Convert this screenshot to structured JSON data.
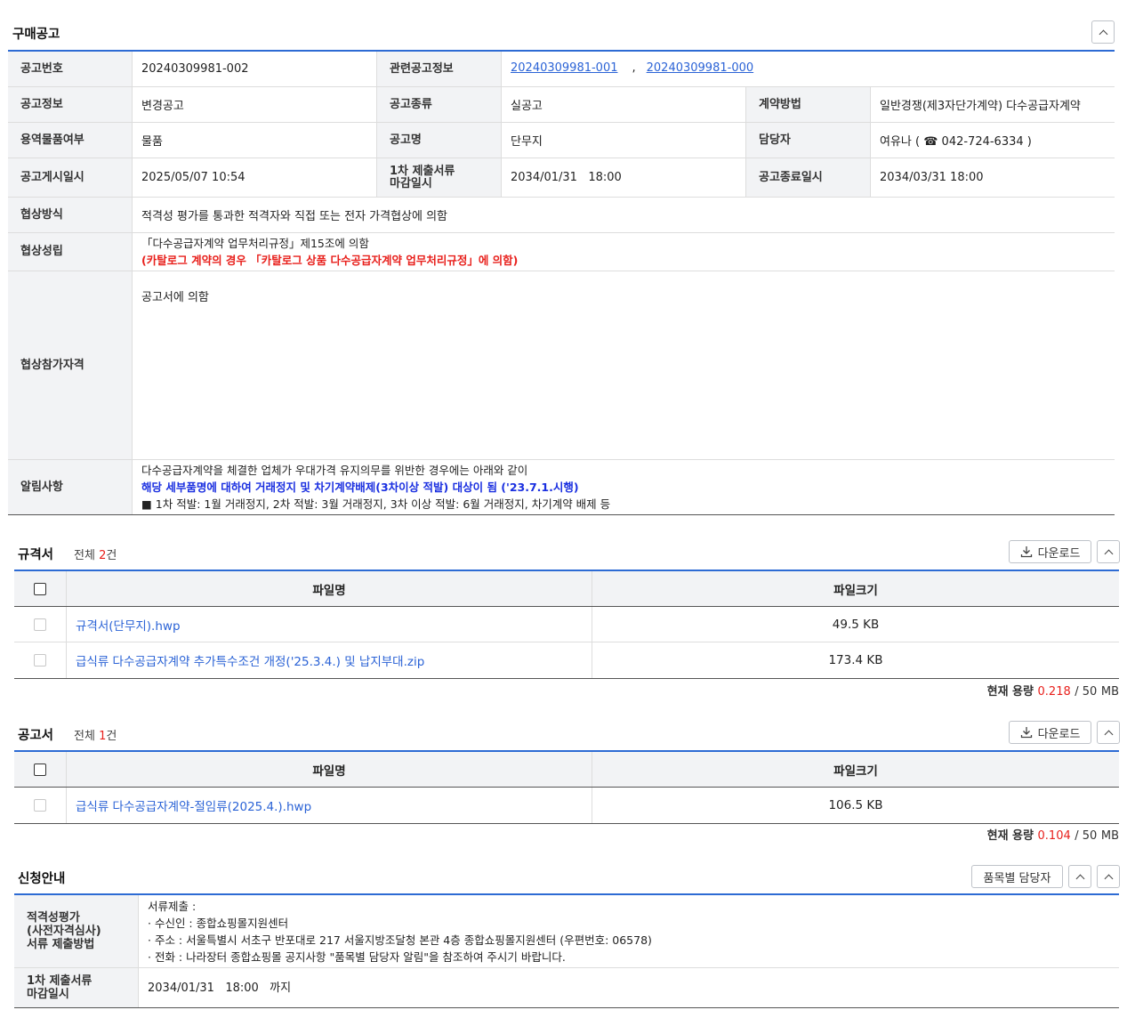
{
  "purchase": {
    "title": "구매공고",
    "rows": {
      "notice_no_label": "공고번호",
      "notice_no": "20240309981-002",
      "related_label": "관련공고정보",
      "related_1": "20240309981-001",
      "related_sep": ",",
      "related_2": "20240309981-000",
      "info_label": "공고정보",
      "info": "변경공고",
      "kind_label": "공고종류",
      "kind": "실공고",
      "method_label": "계약방법",
      "method": "일반경쟁(제3자단가계약) 다수공급자계약",
      "goods_label": "용역물품여부",
      "goods": "물품",
      "name_label": "공고명",
      "name": "단무지",
      "manager_label": "담당자",
      "manager": "여유나 ( ☎ 042-724-6334 )",
      "posted_label": "공고게시일시",
      "posted": "2025/05/07 10:54",
      "deadline1_label": "1차 제출서류 마감일시",
      "deadline1": "2034/01/31   18:00",
      "end_label": "공고종료일시",
      "end": "2034/03/31 18:00",
      "negotiation_label": "협상방식",
      "negotiation": "적격성 평가를 통과한 적격자와 직접 또는 전자 가격협상에 의함",
      "established_label": "협상성립",
      "established_1": "「다수공급자계약 업무처리규정」제15조에 의함",
      "established_2": "(카탈로그 계약의 경우 「카탈로그 상품 다수공급자계약 업무처리규정」에 의함)",
      "qualification_label": "협상참가자격",
      "qualification": "공고서에 의함",
      "notice_label": "알림사항",
      "notice_1": "다수공급자계약을 체결한 업체가 우대가격 유지의무를 위반한 경우에는 아래와 같이",
      "notice_2": "해당 세부품명에 대하여 거래정지 및 차기계약배제(3차이상 적발) 대상이 됨 ('23.7.1.시행)",
      "notice_3": "■ 1차 적발: 1월 거래정지, 2차 적발: 3월 거래정지, 3차 이상 적발: 6월 거래정지, 차기계약 배제 등"
    }
  },
  "spec": {
    "title": "규격서",
    "count_prefix": "전체",
    "count": "2",
    "count_suffix": "건",
    "download": "다운로드",
    "col_name": "파일명",
    "col_size": "파일크기",
    "files": [
      {
        "name": "규격서(단무지).hwp",
        "size": "49.5 KB"
      },
      {
        "name": "급식류 다수공급자계약 추가특수조건 개정('25.3.4.) 및 납지부대.zip",
        "size": "173.4 KB"
      }
    ],
    "cap_label": "현재 용량",
    "cap_used": "0.218",
    "cap_total": "/ 50",
    "cap_unit": "MB"
  },
  "notice_doc": {
    "title": "공고서",
    "count_prefix": "전체",
    "count": "1",
    "count_suffix": "건",
    "download": "다운로드",
    "col_name": "파일명",
    "col_size": "파일크기",
    "files": [
      {
        "name": "급식류 다수공급자계약-절임류(2025.4.).hwp",
        "size": "106.5 KB"
      }
    ],
    "cap_label": "현재 용량",
    "cap_used": "0.104",
    "cap_total": "/ 50",
    "cap_unit": "MB"
  },
  "apply": {
    "title": "신청안내",
    "manager_btn": "품목별 담당자",
    "doc_label_1": "적격성평가",
    "doc_label_2": "(사전자격심사)",
    "doc_label_3": "서류 제출방법",
    "doc_1": "서류제출 :",
    "doc_2": "· 수신인 : 종합쇼핑몰지원센터",
    "doc_3": "· 주소 : 서울특별시 서초구 반포대로 217 서울지방조달청 본관 4층 종합쇼핑몰지원센터 (우편번호: 06578)",
    "doc_4": "· 전화 : 나라장터 종합쇼핑몰 공지사항 \"품목별 담당자 알림\"을 참조하여 주시기 바랍니다.",
    "deadline_label_1": "1차 제출서류",
    "deadline_label_2": "마감일시",
    "deadline": "2034/01/31   18:00   까지"
  }
}
